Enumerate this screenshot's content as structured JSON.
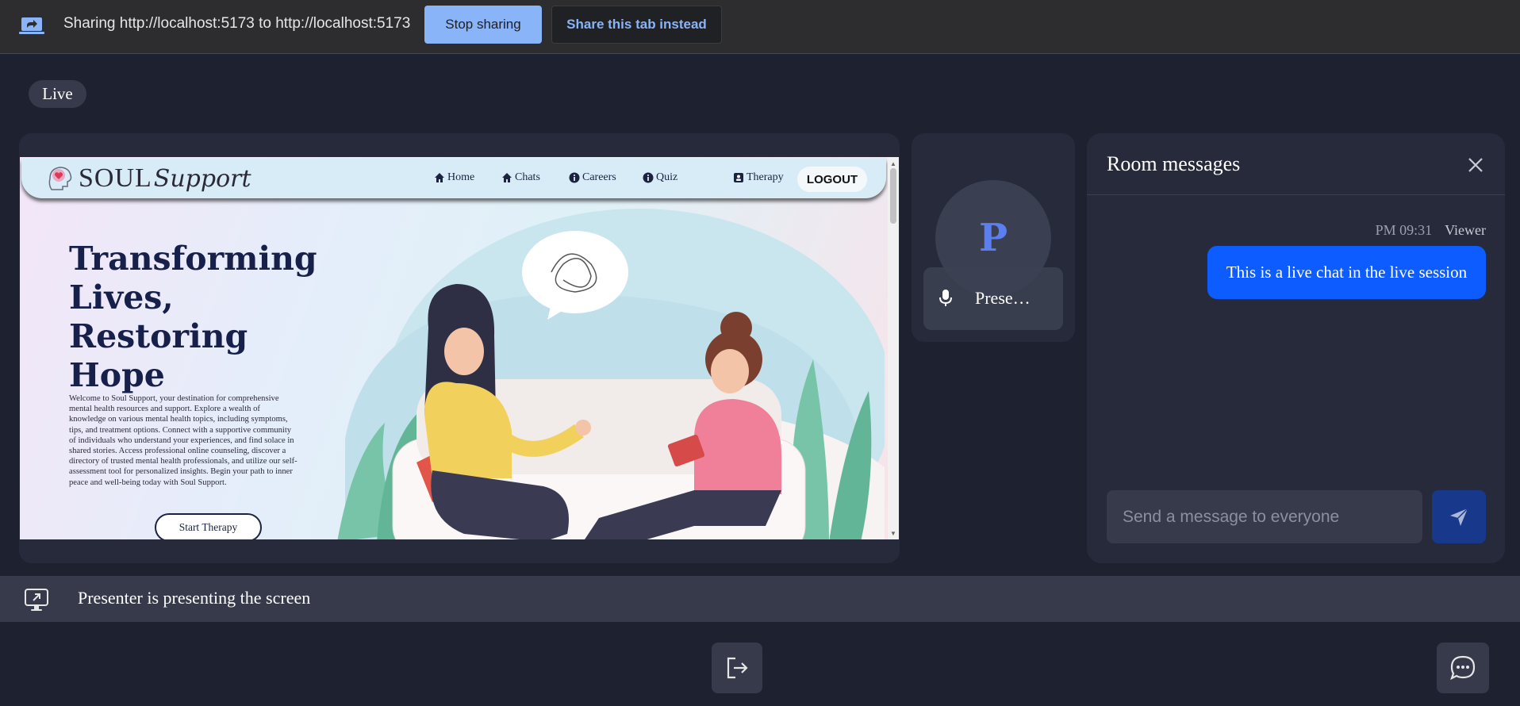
{
  "sharebar": {
    "text": "Sharing http://localhost:5173 to http://localhost:5173",
    "stop_label": "Stop sharing",
    "share_tab_label": "Share this tab instead"
  },
  "live_badge": "Live",
  "shared_screen": {
    "logo_soul": "SOUL",
    "logo_support": "Support",
    "nav": [
      "Home",
      "Chats",
      "Careers",
      "Quiz",
      "Therapy"
    ],
    "logout": "LOGOUT",
    "heading": "Transforming Lives, Restoring Hope",
    "paragraph": "Welcome to Soul Support, your destination for comprehensive mental health resources and support. Explore a wealth of knowledge on various mental health topics, including symptoms, tips, and treatment options. Connect with a supportive community of individuals who understand your experiences, and find solace in shared stories. Access professional online counseling, discover a directory of trusted mental health professionals, and utilize our self-assessment tool for personalized insights. Begin your path to inner peace and well-being today with Soul Support.",
    "start_button": "Start Therapy"
  },
  "participant": {
    "initial": "P",
    "name": "Prese…"
  },
  "chat": {
    "title": "Room messages",
    "messages": [
      {
        "time": "PM 09:31",
        "sender": "Viewer",
        "text": "This is a live chat in the live session"
      }
    ],
    "input_placeholder": "Send a message to everyone"
  },
  "status_text": "Presenter is presenting the screen",
  "colors": {
    "background": "#1e2130",
    "panel": "#262a3a",
    "accent": "#0d5cff",
    "send_button": "#18388c",
    "avatar_letter": "#5b7ef0"
  }
}
